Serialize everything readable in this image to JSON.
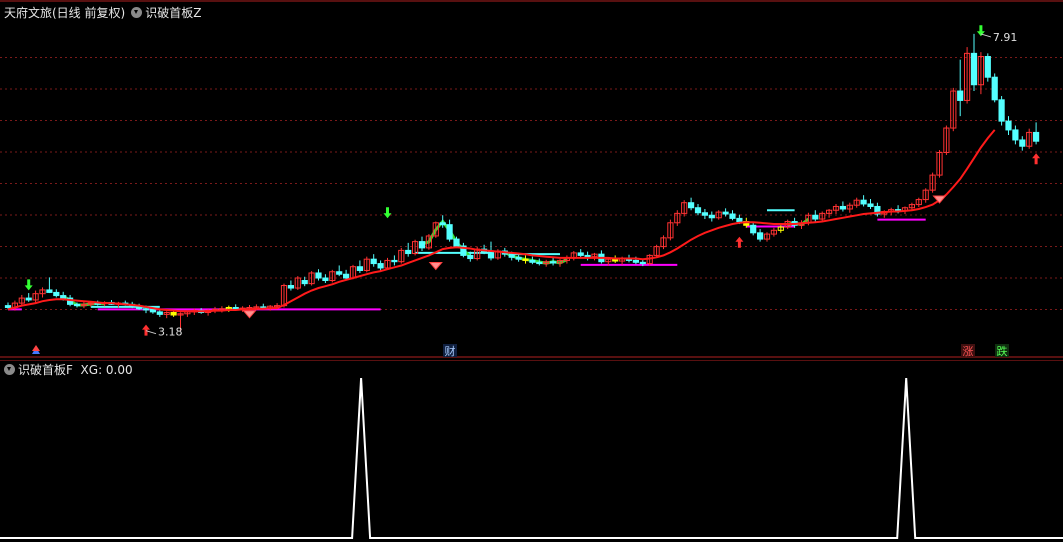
{
  "header": {
    "stock_title": "天府文旅(日线 前复权)",
    "indicator_main": "识破首板Z"
  },
  "sub_header": {
    "indicator_sub": "识破首板F",
    "xg_label": "XG: 0.00"
  },
  "markers": {
    "high_price": "7.91",
    "low_price": "3.18",
    "cai_label": "财",
    "zhang_label": "涨",
    "die_label": "跌"
  },
  "colors": {
    "background": "#000000",
    "up_candle": "#ff3232",
    "down_candle": "#54ffff",
    "ma_line": "#ff1a1a",
    "support_line": "#ff00ff",
    "resistance_line": "#54ffff",
    "band_green": "#33dd33",
    "yellow_candle": "#ffff00",
    "grid": "#7a1a1a",
    "xg_line": "#ffffff"
  },
  "chart_data": {
    "type": "candlestick",
    "price_range": [
      3.0,
      8.1
    ],
    "candles": [
      [
        3.58,
        3.63,
        3.52,
        3.55
      ],
      [
        3.55,
        3.66,
        3.5,
        3.62
      ],
      [
        3.62,
        3.75,
        3.58,
        3.7
      ],
      [
        3.7,
        3.78,
        3.64,
        3.67
      ],
      [
        3.67,
        3.82,
        3.62,
        3.77
      ],
      [
        3.77,
        3.87,
        3.71,
        3.83
      ],
      [
        3.83,
        4.03,
        3.78,
        3.79
      ],
      [
        3.79,
        3.84,
        3.71,
        3.74
      ],
      [
        3.74,
        3.8,
        3.66,
        3.7
      ],
      [
        3.7,
        3.75,
        3.57,
        3.6
      ],
      [
        3.6,
        3.63,
        3.55,
        3.58
      ],
      [
        3.58,
        3.64,
        3.54,
        3.6
      ],
      [
        3.6,
        3.65,
        3.56,
        3.62
      ],
      [
        3.62,
        3.66,
        3.58,
        3.61
      ],
      [
        3.61,
        3.65,
        3.57,
        3.63
      ],
      [
        3.63,
        3.67,
        3.59,
        3.6
      ],
      [
        3.6,
        3.64,
        3.55,
        3.62
      ],
      [
        3.62,
        3.66,
        3.58,
        3.6
      ],
      [
        3.6,
        3.64,
        3.54,
        3.57
      ],
      [
        3.57,
        3.61,
        3.51,
        3.53
      ],
      [
        3.53,
        3.58,
        3.46,
        3.52
      ],
      [
        3.52,
        3.56,
        3.45,
        3.48
      ],
      [
        3.48,
        3.52,
        3.4,
        3.44
      ],
      [
        3.44,
        3.49,
        3.38,
        3.47
      ],
      [
        3.47,
        3.51,
        3.4,
        3.43
      ],
      [
        3.43,
        3.47,
        3.18,
        3.45
      ],
      [
        3.45,
        3.5,
        3.4,
        3.48
      ],
      [
        3.48,
        3.53,
        3.43,
        3.5
      ],
      [
        3.5,
        3.54,
        3.45,
        3.47
      ],
      [
        3.47,
        3.52,
        3.42,
        3.5
      ],
      [
        3.5,
        3.56,
        3.46,
        3.52
      ],
      [
        3.52,
        3.57,
        3.47,
        3.53
      ],
      [
        3.53,
        3.58,
        3.48,
        3.55
      ],
      [
        3.55,
        3.6,
        3.5,
        3.52
      ],
      [
        3.52,
        3.57,
        3.48,
        3.54
      ],
      [
        3.54,
        3.59,
        3.5,
        3.55
      ],
      [
        3.55,
        3.6,
        3.51,
        3.56
      ],
      [
        3.56,
        3.61,
        3.52,
        3.54
      ],
      [
        3.54,
        3.59,
        3.5,
        3.57
      ],
      [
        3.57,
        3.62,
        3.53,
        3.58
      ],
      [
        3.58,
        3.93,
        3.55,
        3.9
      ],
      [
        3.9,
        3.98,
        3.82,
        3.86
      ],
      [
        3.86,
        4.05,
        3.83,
        4.02
      ],
      [
        3.98,
        4.04,
        3.89,
        3.93
      ],
      [
        3.93,
        4.13,
        3.9,
        4.1
      ],
      [
        4.1,
        4.16,
        3.98,
        4.02
      ],
      [
        4.02,
        4.08,
        3.94,
        3.98
      ],
      [
        3.98,
        4.15,
        3.95,
        4.12
      ],
      [
        4.12,
        4.22,
        4.05,
        4.08
      ],
      [
        4.08,
        4.15,
        3.98,
        4.02
      ],
      [
        4.02,
        4.23,
        4.0,
        4.2
      ],
      [
        4.2,
        4.3,
        4.1,
        4.14
      ],
      [
        4.14,
        4.36,
        4.11,
        4.32
      ],
      [
        4.32,
        4.4,
        4.2,
        4.25
      ],
      [
        4.25,
        4.3,
        4.13,
        4.18
      ],
      [
        4.18,
        4.34,
        4.15,
        4.3
      ],
      [
        4.3,
        4.38,
        4.22,
        4.28
      ],
      [
        4.28,
        4.5,
        4.25,
        4.46
      ],
      [
        4.46,
        4.58,
        4.36,
        4.41
      ],
      [
        4.41,
        4.63,
        4.38,
        4.6
      ],
      [
        4.6,
        4.68,
        4.45,
        4.5
      ],
      [
        4.5,
        4.72,
        4.47,
        4.69
      ],
      [
        4.69,
        4.92,
        4.66,
        4.9
      ],
      [
        4.9,
        5.02,
        4.82,
        4.87
      ],
      [
        4.87,
        4.95,
        4.6,
        4.64
      ],
      [
        4.64,
        4.68,
        4.5,
        4.53
      ],
      [
        4.53,
        4.58,
        4.35,
        4.38
      ],
      [
        4.38,
        4.44,
        4.28,
        4.33
      ],
      [
        4.33,
        4.52,
        4.3,
        4.48
      ],
      [
        4.48,
        4.55,
        4.4,
        4.44
      ],
      [
        4.44,
        4.6,
        4.3,
        4.34
      ],
      [
        4.34,
        4.48,
        4.31,
        4.45
      ],
      [
        4.45,
        4.5,
        4.36,
        4.4
      ],
      [
        4.4,
        4.44,
        4.3,
        4.35
      ],
      [
        4.35,
        4.4,
        4.28,
        4.32
      ],
      [
        4.32,
        4.38,
        4.25,
        4.3
      ],
      [
        4.3,
        4.36,
        4.24,
        4.27
      ],
      [
        4.27,
        4.33,
        4.22,
        4.25
      ],
      [
        4.25,
        4.31,
        4.2,
        4.28
      ],
      [
        4.28,
        4.34,
        4.22,
        4.26
      ],
      [
        4.26,
        4.32,
        4.2,
        4.3
      ],
      [
        4.3,
        4.38,
        4.25,
        4.34
      ],
      [
        4.34,
        4.45,
        4.3,
        4.42
      ],
      [
        4.42,
        4.48,
        4.34,
        4.38
      ],
      [
        4.38,
        4.44,
        4.3,
        4.36
      ],
      [
        4.36,
        4.42,
        4.3,
        4.4
      ],
      [
        4.4,
        4.46,
        4.25,
        4.28
      ],
      [
        4.28,
        4.35,
        4.22,
        4.32
      ],
      [
        4.32,
        4.38,
        4.26,
        4.29
      ],
      [
        4.29,
        4.36,
        4.23,
        4.33
      ],
      [
        4.33,
        4.39,
        4.27,
        4.3
      ],
      [
        4.3,
        4.36,
        4.24,
        4.27
      ],
      [
        4.27,
        4.33,
        4.21,
        4.25
      ],
      [
        4.25,
        4.4,
        4.22,
        4.38
      ],
      [
        4.38,
        4.55,
        4.35,
        4.52
      ],
      [
        4.52,
        4.7,
        4.48,
        4.66
      ],
      [
        4.66,
        4.95,
        4.62,
        4.9
      ],
      [
        4.9,
        5.1,
        4.85,
        5.05
      ],
      [
        5.05,
        5.26,
        5.0,
        5.22
      ],
      [
        5.22,
        5.3,
        5.1,
        5.14
      ],
      [
        5.14,
        5.2,
        5.02,
        5.06
      ],
      [
        5.06,
        5.12,
        4.96,
        5.02
      ],
      [
        5.02,
        5.08,
        4.92,
        4.98
      ],
      [
        4.98,
        5.1,
        4.95,
        5.07
      ],
      [
        5.07,
        5.13,
        5.0,
        5.04
      ],
      [
        5.04,
        5.1,
        4.94,
        4.97
      ],
      [
        4.97,
        5.03,
        4.88,
        4.92
      ],
      [
        4.92,
        4.98,
        4.82,
        4.86
      ],
      [
        4.86,
        4.92,
        4.7,
        4.74
      ],
      [
        4.74,
        4.8,
        4.6,
        4.64
      ],
      [
        4.64,
        4.75,
        4.6,
        4.72
      ],
      [
        4.72,
        4.82,
        4.68,
        4.78
      ],
      [
        4.78,
        4.86,
        4.74,
        4.83
      ],
      [
        4.83,
        4.95,
        4.8,
        4.92
      ],
      [
        4.92,
        4.98,
        4.82,
        4.86
      ],
      [
        4.86,
        4.94,
        4.8,
        4.9
      ],
      [
        4.9,
        5.06,
        4.86,
        5.02
      ],
      [
        5.02,
        5.1,
        4.92,
        4.96
      ],
      [
        4.96,
        5.08,
        4.93,
        5.05
      ],
      [
        5.05,
        5.12,
        4.98,
        5.1
      ],
      [
        5.1,
        5.2,
        5.04,
        5.16
      ],
      [
        5.16,
        5.24,
        5.08,
        5.12
      ],
      [
        5.12,
        5.22,
        5.06,
        5.18
      ],
      [
        5.18,
        5.3,
        5.14,
        5.26
      ],
      [
        5.26,
        5.34,
        5.16,
        5.2
      ],
      [
        5.2,
        5.28,
        5.12,
        5.16
      ],
      [
        5.16,
        5.22,
        5.0,
        5.04
      ],
      [
        5.04,
        5.1,
        4.98,
        5.08
      ],
      [
        5.08,
        5.14,
        5.02,
        5.11
      ],
      [
        5.11,
        5.18,
        5.05,
        5.09
      ],
      [
        5.09,
        5.16,
        5.04,
        5.14
      ],
      [
        5.14,
        5.22,
        5.1,
        5.19
      ],
      [
        5.19,
        5.3,
        5.15,
        5.27
      ],
      [
        5.27,
        5.45,
        5.22,
        5.42
      ],
      [
        5.42,
        5.7,
        5.38,
        5.66
      ],
      [
        5.66,
        6.06,
        5.62,
        6.02
      ],
      [
        6.02,
        6.45,
        5.98,
        6.41
      ],
      [
        6.41,
        7.05,
        6.36,
        7.0
      ],
      [
        7.0,
        7.5,
        6.6,
        6.85
      ],
      [
        6.85,
        7.7,
        6.8,
        7.6
      ],
      [
        7.6,
        7.91,
        7.0,
        7.1
      ],
      [
        7.1,
        7.62,
        6.95,
        7.55
      ],
      [
        7.55,
        7.6,
        7.15,
        7.22
      ],
      [
        7.22,
        7.28,
        6.82,
        6.86
      ],
      [
        6.86,
        6.92,
        6.45,
        6.52
      ],
      [
        6.52,
        6.6,
        6.3,
        6.38
      ],
      [
        6.38,
        6.45,
        6.15,
        6.22
      ],
      [
        6.22,
        6.28,
        6.05,
        6.12
      ],
      [
        6.12,
        6.4,
        6.08,
        6.34
      ],
      [
        6.34,
        6.5,
        6.15,
        6.2
      ]
    ],
    "ma": [
      3.52,
      3.55,
      3.58,
      3.6,
      3.62,
      3.65,
      3.67,
      3.68,
      3.68,
      3.67,
      3.66,
      3.65,
      3.64,
      3.63,
      3.62,
      3.62,
      3.61,
      3.6,
      3.59,
      3.58,
      3.56,
      3.54,
      3.52,
      3.51,
      3.5,
      3.49,
      3.49,
      3.49,
      3.49,
      3.49,
      3.5,
      3.5,
      3.51,
      3.51,
      3.52,
      3.52,
      3.53,
      3.53,
      3.54,
      3.54,
      3.59,
      3.65,
      3.71,
      3.77,
      3.82,
      3.86,
      3.89,
      3.92,
      3.96,
      3.99,
      4.02,
      4.05,
      4.08,
      4.11,
      4.13,
      4.16,
      4.19,
      4.22,
      4.26,
      4.3,
      4.34,
      4.38,
      4.43,
      4.48,
      4.5,
      4.51,
      4.5,
      4.49,
      4.47,
      4.46,
      4.45,
      4.44,
      4.43,
      4.42,
      4.41,
      4.4,
      4.38,
      4.37,
      4.36,
      4.35,
      4.34,
      4.34,
      4.34,
      4.34,
      4.34,
      4.34,
      4.34,
      4.34,
      4.33,
      4.33,
      4.33,
      4.33,
      4.32,
      4.33,
      4.35,
      4.38,
      4.43,
      4.49,
      4.56,
      4.63,
      4.69,
      4.74,
      4.78,
      4.82,
      4.85,
      4.88,
      4.9,
      4.91,
      4.91,
      4.9,
      4.89,
      4.88,
      4.88,
      4.88,
      4.88,
      4.89,
      4.9,
      4.91,
      4.92,
      4.94,
      4.96,
      4.98,
      5.0,
      5.02,
      5.04,
      5.05,
      5.06,
      5.07,
      5.08,
      5.08,
      5.09,
      5.1,
      5.12,
      5.15,
      5.19,
      5.26,
      5.35,
      5.47,
      5.6,
      5.76,
      5.93,
      6.1,
      6.25,
      6.38
    ],
    "support_lines": [
      {
        "start": 0,
        "end": 2,
        "price": 3.52,
        "color": "support"
      },
      {
        "start": 13,
        "end": 54,
        "price": 3.52,
        "color": "support"
      },
      {
        "start": 83,
        "end": 97,
        "price": 4.23,
        "color": "support"
      },
      {
        "start": 107,
        "end": 114,
        "price": 4.84,
        "color": "support"
      },
      {
        "start": 126,
        "end": 133,
        "price": 4.95,
        "color": "support"
      },
      {
        "start": 110,
        "end": 114,
        "price": 5.1,
        "color": "resistance"
      },
      {
        "start": 59,
        "end": 70,
        "price": 4.42,
        "color": "resistance"
      },
      {
        "start": 73,
        "end": 80,
        "price": 4.4,
        "color": "resistance"
      },
      {
        "start": 12,
        "end": 22,
        "price": 3.56,
        "color": "resistance"
      }
    ],
    "xg_signals": [
      {
        "index": 49,
        "value": 1
      },
      {
        "index": 128,
        "value": 1
      }
    ]
  }
}
